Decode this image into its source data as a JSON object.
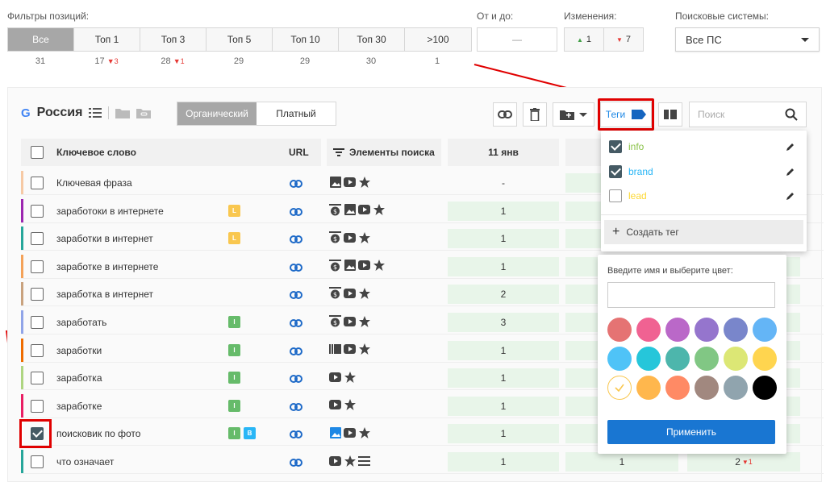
{
  "filters": {
    "label": "Фильтры позиций:",
    "tabs": [
      {
        "label": "Все",
        "count": "31",
        "delta": ""
      },
      {
        "label": "Топ 1",
        "count": "17",
        "delta": "3"
      },
      {
        "label": "Топ 3",
        "count": "28",
        "delta": "1"
      },
      {
        "label": "Топ 5",
        "count": "29",
        "delta": ""
      },
      {
        "label": "Топ 10",
        "count": "29",
        "delta": ""
      },
      {
        "label": "Топ 30",
        "count": "30",
        "delta": ""
      },
      {
        "label": ">100",
        "count": "1",
        "delta": ""
      }
    ],
    "range_label": "От и до:",
    "range_value": "—",
    "changes_label": "Изменения:",
    "changes_up": "1",
    "changes_down": "7",
    "engines_label": "Поисковые системы:",
    "engines_value": "Все ПС"
  },
  "toolbar": {
    "engine_logo": "G",
    "region": "Россия",
    "type_tabs": [
      "Органический",
      "Платный"
    ],
    "tags_label": "Теги",
    "search_placeholder": "Поиск"
  },
  "table": {
    "headers": {
      "keyword": "Ключевое слово",
      "url": "URL",
      "elements": "Элементы поиска",
      "date1": "11 янв"
    },
    "rows": [
      {
        "keyword": "Ключевая фраза",
        "bar": "#f6c9a4",
        "tags": [],
        "elems": [
          "image",
          "video",
          "star"
        ],
        "pos": "-",
        "pos2": "",
        "pos3": "",
        "checked": false
      },
      {
        "keyword": "заработоки в интернете",
        "bar": "#9c27b0",
        "tags": [
          {
            "t": "L",
            "c": "#f9c74f"
          }
        ],
        "elems": [
          "money",
          "image",
          "video",
          "star"
        ],
        "pos": "1",
        "pos2": "",
        "pos3": "",
        "checked": false
      },
      {
        "keyword": "заработки в интернет",
        "bar": "#26a69a",
        "tags": [
          {
            "t": "L",
            "c": "#f9c74f"
          }
        ],
        "elems": [
          "money",
          "video",
          "star"
        ],
        "pos": "1",
        "pos2": "",
        "pos3": "",
        "checked": false
      },
      {
        "keyword": "заработке в интернете",
        "bar": "#f4a259",
        "tags": [],
        "elems": [
          "money",
          "image",
          "video",
          "star"
        ],
        "pos": "1",
        "pos2": "",
        "pos3": "",
        "checked": false
      },
      {
        "keyword": "заработка в интернет",
        "bar": "#c9a27e",
        "tags": [],
        "elems": [
          "money",
          "video",
          "star"
        ],
        "pos": "2",
        "pos2": "",
        "pos3": "",
        "checked": false
      },
      {
        "keyword": "заработать",
        "bar": "#90a4e8",
        "tags": [
          {
            "t": "I",
            "c": "#66bb6a"
          }
        ],
        "elems": [
          "money",
          "video",
          "star"
        ],
        "pos": "3",
        "pos2": "",
        "pos3": "",
        "checked": false
      },
      {
        "keyword": "заработки",
        "bar": "#ef6c00",
        "tags": [
          {
            "t": "I",
            "c": "#66bb6a"
          }
        ],
        "elems": [
          "carousel",
          "video",
          "star"
        ],
        "pos": "1",
        "pos2": "",
        "pos3": "",
        "checked": false
      },
      {
        "keyword": "заработка",
        "bar": "#aed581",
        "tags": [
          {
            "t": "I",
            "c": "#66bb6a"
          }
        ],
        "elems": [
          "video",
          "star"
        ],
        "pos": "1",
        "pos2": "",
        "pos3": "",
        "checked": false
      },
      {
        "keyword": "заработке",
        "bar": "#e91e63",
        "tags": [
          {
            "t": "I",
            "c": "#66bb6a"
          }
        ],
        "elems": [
          "video",
          "star"
        ],
        "pos": "1",
        "pos2": "",
        "pos3": "",
        "checked": false
      },
      {
        "keyword": "поисковик по фото",
        "bar": "#ffffff",
        "tags": [
          {
            "t": "I",
            "c": "#66bb6a"
          },
          {
            "t": "B",
            "c": "#29b6f6"
          }
        ],
        "elems": [
          "image-blue",
          "video",
          "star"
        ],
        "pos": "1",
        "pos2": "",
        "pos3": "",
        "checked": true
      },
      {
        "keyword": "что означает",
        "bar": "#26a69a",
        "tags": [],
        "elems": [
          "video",
          "star",
          "list"
        ],
        "pos": "1",
        "pos2": "1",
        "pos3": "2",
        "pos3_delta": "1",
        "checked": false
      }
    ]
  },
  "tag_menu": {
    "items": [
      {
        "label": "info",
        "color": "#8bc34a",
        "checked": true
      },
      {
        "label": "brand",
        "color": "#29b6f6",
        "checked": true
      },
      {
        "label": "lead",
        "color": "#fdd835",
        "checked": false
      }
    ],
    "create_label": "Создать тег"
  },
  "color_picker": {
    "title": "Введите имя и выберите цвет:",
    "apply_label": "Применить",
    "colors": [
      "#e57373",
      "#f06292",
      "#ba68c8",
      "#9575cd",
      "#7986cb",
      "#64b5f6",
      "#4fc3f7",
      "#26c6da",
      "#4db6ac",
      "#81c784",
      "#dce775",
      "#ffd54f",
      "#ffffff",
      "#ffb74d",
      "#ff8a65",
      "#a1887f",
      "#90a4ae",
      "#000000"
    ],
    "selected_index": 12
  }
}
